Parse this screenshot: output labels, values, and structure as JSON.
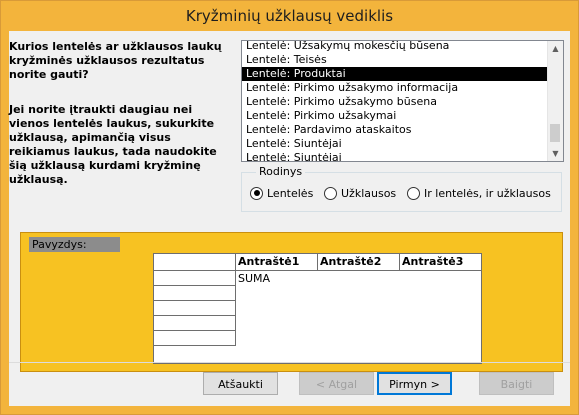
{
  "window": {
    "title": "Kryžminių užklausų vediklis"
  },
  "prompt": {
    "question": "Kurios lentelės ar užklausos laukų kryžminės užklausos rezultatus norite gauti?",
    "hint": "Jei norite įtraukti daugiau nei vienos lentelės laukus, sukurkite užklausą, apimančią visus reikiamus laukus, tada naudokite šią užklausą kurdami kryžminę užklausą."
  },
  "sources": {
    "items": [
      {
        "label": "Lentelė: Užsakymų mokesčių būsena",
        "selected": false
      },
      {
        "label": "Lentelė: Teisės",
        "selected": false
      },
      {
        "label": "Lentelė: Produktai",
        "selected": true
      },
      {
        "label": "Lentelė: Pirkimo užsakymo informacija",
        "selected": false
      },
      {
        "label": "Lentelė: Pirkimo užsakymo būsena",
        "selected": false
      },
      {
        "label": "Lentelė: Pirkimo užsakymai",
        "selected": false
      },
      {
        "label": "Lentelė: Pardavimo ataskaitos",
        "selected": false
      },
      {
        "label": "Lentelė: Siuntėjai",
        "selected": false
      },
      {
        "label": "Lentelė: Siuntėjai",
        "selected": false
      }
    ]
  },
  "view": {
    "title": "Rodinys",
    "options": [
      {
        "label": "Lentelės",
        "selected": true
      },
      {
        "label": "Užklausos",
        "selected": false
      },
      {
        "label": "Ir lentelės, ir užklausos",
        "selected": false
      }
    ]
  },
  "sample": {
    "label": "Pavyzdys:",
    "columns": [
      "Antraštė1",
      "Antraštė2",
      "Antraštė3"
    ],
    "value": "SUMA"
  },
  "buttons": {
    "cancel": "Atšaukti",
    "back": "< Atgal",
    "next": "Pirmyn >",
    "finish": "Baigti"
  },
  "colors": {
    "accent": "#f3b43c",
    "selection": "#000000",
    "preview_bg": "#f7c222"
  }
}
